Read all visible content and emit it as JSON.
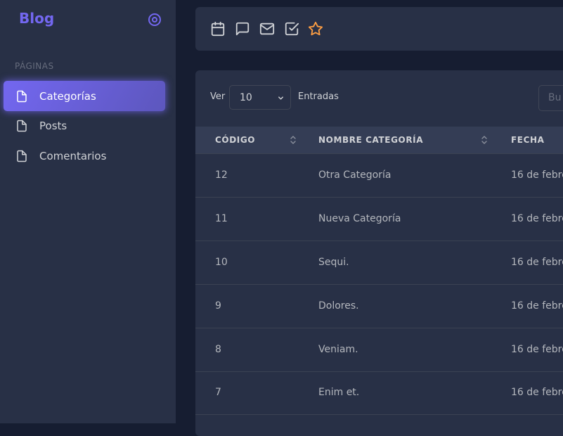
{
  "sidebar": {
    "brand": "Blog",
    "section_label": "PÁGINAS",
    "items": [
      {
        "label": "Categorías",
        "active": true
      },
      {
        "label": "Posts",
        "active": false
      },
      {
        "label": "Comentarios",
        "active": false
      }
    ]
  },
  "topbar": {
    "icons": [
      "calendar-icon",
      "message-square-icon",
      "mail-icon",
      "check-square-icon",
      "star-icon"
    ],
    "star_color": "#ff9f43"
  },
  "table": {
    "show_label": "Ver",
    "page_size": "10",
    "entries_label": "Entradas",
    "search_placeholder": "Bu",
    "columns": [
      "CÓDIGO",
      "NOMBRE CATEGORÍA",
      "FECHA"
    ],
    "rows": [
      {
        "code": "12",
        "name": "Otra Categoría",
        "date": "16 de febre"
      },
      {
        "code": "11",
        "name": "Nueva Categoría",
        "date": "16 de febre"
      },
      {
        "code": "10",
        "name": "Sequi.",
        "date": "16 de febre"
      },
      {
        "code": "9",
        "name": "Dolores.",
        "date": "16 de febre"
      },
      {
        "code": "8",
        "name": "Veniam.",
        "date": "16 de febre"
      },
      {
        "code": "7",
        "name": "Enim et.",
        "date": "16 de febre"
      }
    ]
  },
  "colors": {
    "accent": "#7367f0",
    "background": "#161d31",
    "panel": "#283046",
    "header": "#343d55"
  }
}
